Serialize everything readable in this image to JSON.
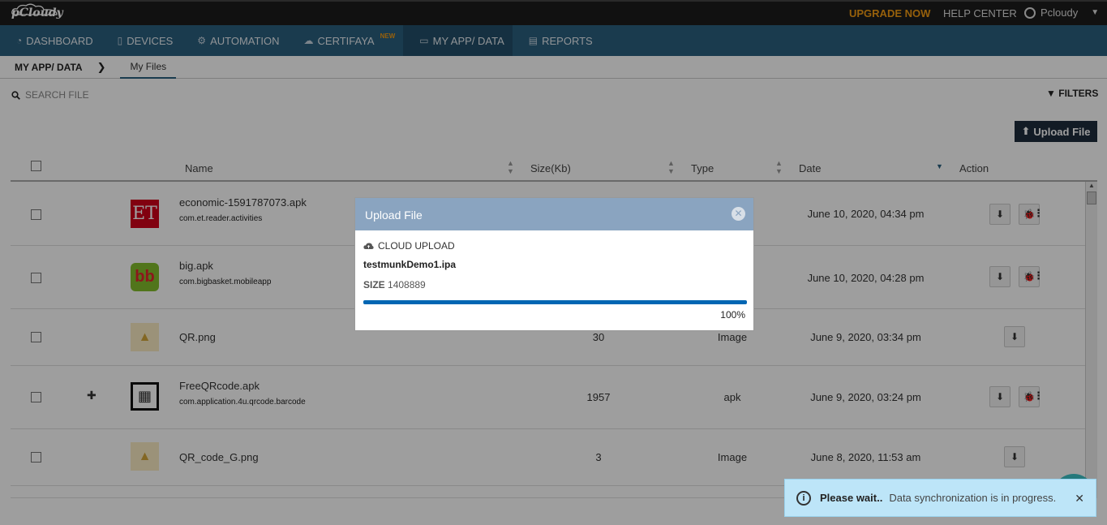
{
  "brand": {
    "logo_text": "pCloudy"
  },
  "topbar": {
    "upgrade": "UPGRADE NOW",
    "help": "HELP CENTER",
    "user": "Pcloudy"
  },
  "nav": [
    {
      "label": "DASHBOARD",
      "icon": "dashboard-icon"
    },
    {
      "label": "DEVICES",
      "icon": "mobile-icon"
    },
    {
      "label": "AUTOMATION",
      "icon": "gears-icon"
    },
    {
      "label": "CERTIFAYA",
      "icon": "cloud-icon",
      "badge": "NEW"
    },
    {
      "label": "MY APP/ DATA",
      "icon": "folder-icon",
      "active": true
    },
    {
      "label": "REPORTS",
      "icon": "report-icon"
    }
  ],
  "breadcrumb": {
    "root": "MY APP/ DATA",
    "current": "My Files"
  },
  "search": {
    "placeholder": "SEARCH FILE"
  },
  "filters": "FILTERS",
  "upload_button": "Upload File",
  "table": {
    "headers": {
      "name": "Name",
      "size": "Size(Kb)",
      "type": "Type",
      "date": "Date",
      "action": "Action"
    },
    "rows": [
      {
        "name": "economic-1591787073.apk",
        "package": "com.et.reader.activities",
        "size": "",
        "type": "",
        "date": "June 10, 2020, 04:34 pm",
        "thumb": "et-logo"
      },
      {
        "name": "big.apk",
        "package": "com.bigbasket.mobileapp",
        "size": "",
        "type": "",
        "date": "June 10, 2020, 04:28 pm",
        "thumb": "bb-logo"
      },
      {
        "name": "QR.png",
        "package": "",
        "size": "30",
        "type": "Image",
        "date": "June 9, 2020, 03:34 pm",
        "thumb": "image"
      },
      {
        "name": "FreeQRcode.apk",
        "package": "com.application.4u.qrcode.barcode",
        "size": "1957",
        "type": "apk",
        "date": "June 9, 2020, 03:24 pm",
        "thumb": "qr"
      },
      {
        "name": "QR_code_G.png",
        "package": "",
        "size": "3",
        "type": "Image",
        "date": "June 8, 2020, 11:53 am",
        "thumb": "image"
      }
    ]
  },
  "modal": {
    "title": "Upload File",
    "source": "CLOUD UPLOAD",
    "filename": "testmunkDemo1.ipa",
    "size_label": "SIZE",
    "size_value": "1408889",
    "progress": 1.0,
    "progress_text": "100%"
  },
  "toast": {
    "title": "Please wait..",
    "message": "Data synchronization is in progress."
  },
  "colors": {
    "nav": "#2b5f7f",
    "accent": "#f39c12",
    "progress": "#0066b3",
    "toast": "#bde5f8"
  }
}
